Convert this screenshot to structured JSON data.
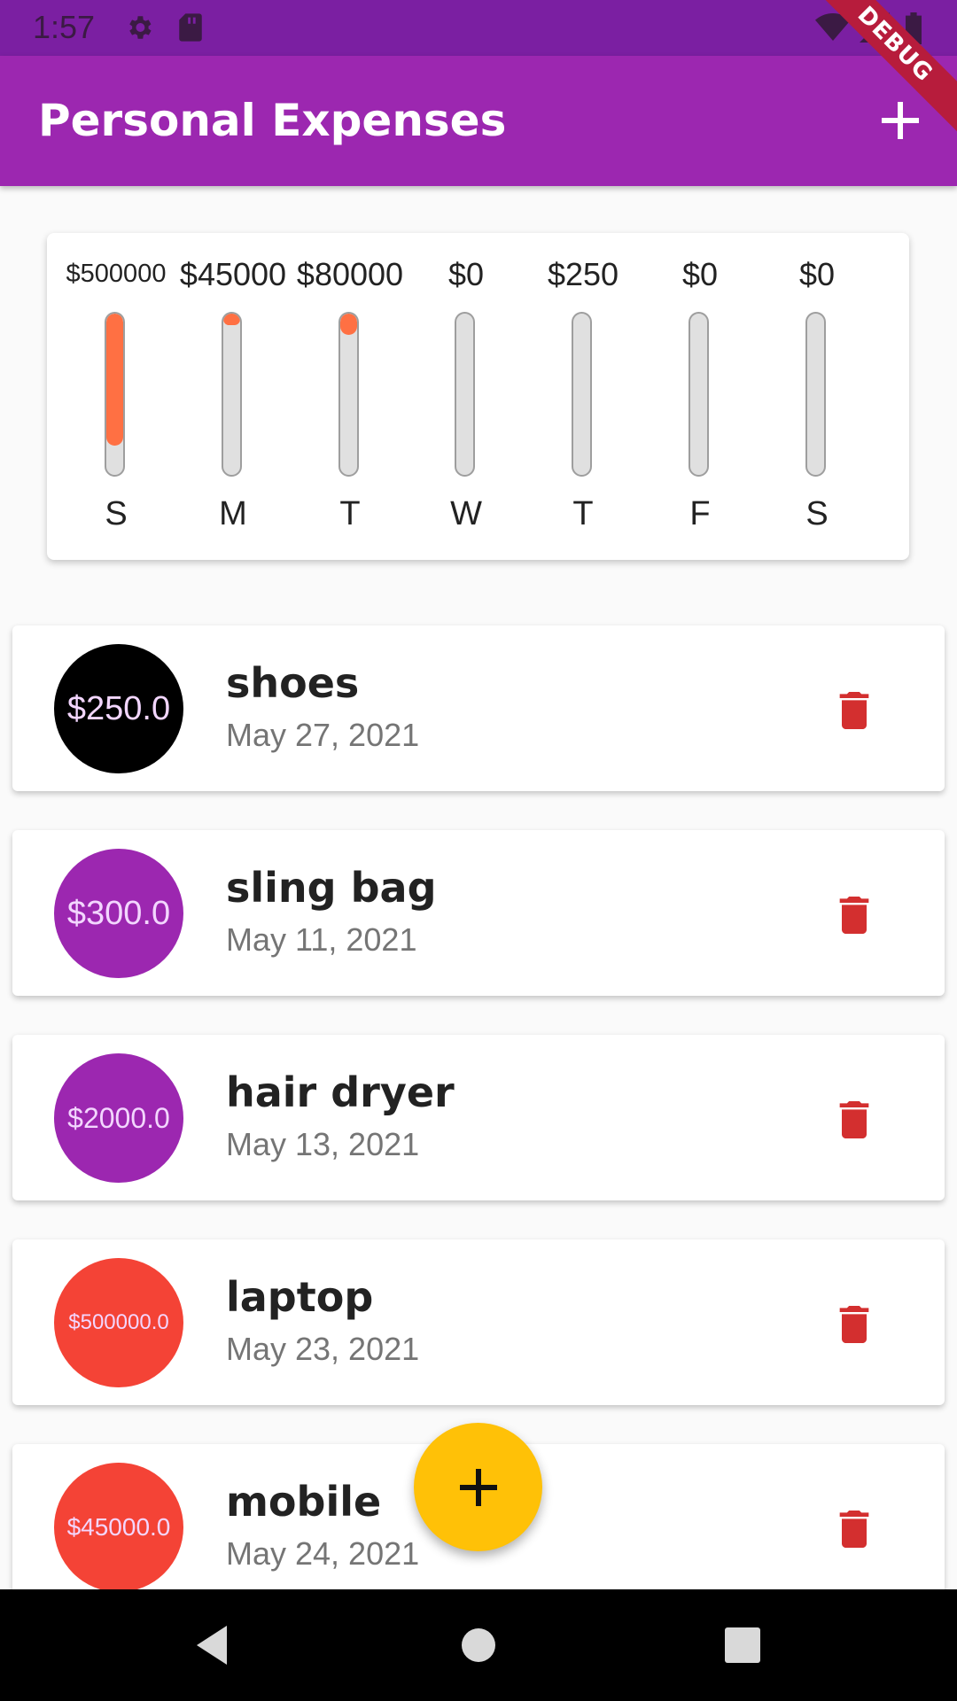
{
  "status_bar": {
    "time": "1:57",
    "icons": [
      "gear-icon",
      "sd-card-icon",
      "wifi-icon",
      "signal-icon",
      "battery-icon"
    ]
  },
  "app_bar": {
    "title": "Personal Expenses",
    "add_icon": "plus-icon",
    "background": "#9c27b0"
  },
  "debug_banner": "DEBUG",
  "chart": {
    "bars": [
      {
        "day": "S",
        "amount": "$500000",
        "fill": 0.8
      },
      {
        "day": "M",
        "amount": "$45000",
        "fill": 0.07
      },
      {
        "day": "T",
        "amount": "$80000",
        "fill": 0.13
      },
      {
        "day": "W",
        "amount": "$0",
        "fill": 0
      },
      {
        "day": "T",
        "amount": "$250",
        "fill": 0
      },
      {
        "day": "F",
        "amount": "$0",
        "fill": 0
      },
      {
        "day": "S",
        "amount": "$0",
        "fill": 0
      }
    ],
    "fill_color": "#ff7043"
  },
  "transactions": [
    {
      "amount": "$250.0",
      "title": "shoes",
      "date": "May 27, 2021",
      "color": "#000000"
    },
    {
      "amount": "$300.0",
      "title": "sling bag",
      "date": "May 11, 2021",
      "color": "#9c27b0"
    },
    {
      "amount": "$2000.0",
      "title": "hair dryer",
      "date": "May 13, 2021",
      "color": "#9c27b0"
    },
    {
      "amount": "$500000.0",
      "title": "laptop",
      "date": "May 23, 2021",
      "color": "#f44336"
    },
    {
      "amount": "$45000.0",
      "title": "mobile",
      "date": "May 24, 2021",
      "color": "#f44336"
    }
  ],
  "delete_icon": "trash-icon",
  "delete_color": "#d32f2f",
  "fab": {
    "icon": "plus-icon",
    "color": "#ffc107"
  },
  "nav_bar": {
    "icons": [
      "back-icon",
      "home-icon",
      "recents-icon"
    ]
  }
}
